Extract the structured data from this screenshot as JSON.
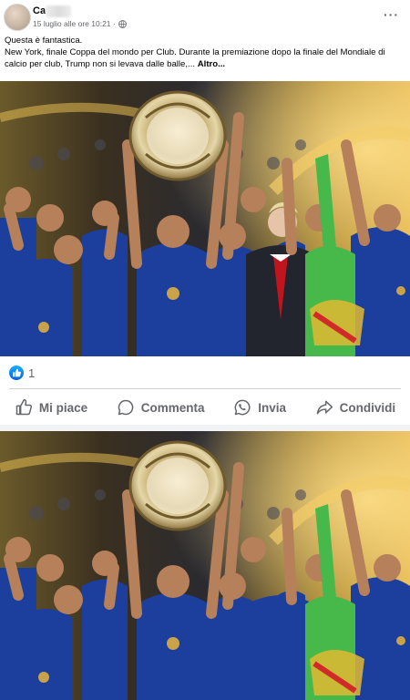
{
  "post": {
    "author": "Ca",
    "timestamp": "15 luglio alle ore 10:21 ·",
    "privacy_icon": "globe-icon",
    "more_label": "···",
    "caption_line1": "Questa è fantastica.",
    "caption_line2": "New York, finale Coppa del mondo per Club. Durante la premiazione dopo la finale del Mondiale di calcio per club, Trump non si levava dalle balle,...",
    "see_more": "Altro..."
  },
  "reactions": {
    "icon": "thumbs-up-icon",
    "count": "1"
  },
  "actions": [
    {
      "label": "Mi piace",
      "icon": "thumbs-up-icon"
    },
    {
      "label": "Commenta",
      "icon": "comment-icon"
    },
    {
      "label": "Invia",
      "icon": "whatsapp-icon"
    },
    {
      "label": "Condividi",
      "icon": "share-icon"
    }
  ],
  "colors": {
    "facebook_blue": "#0866ff",
    "secondary_text": "#65676b",
    "kit_blue": "#1c3f9e"
  }
}
